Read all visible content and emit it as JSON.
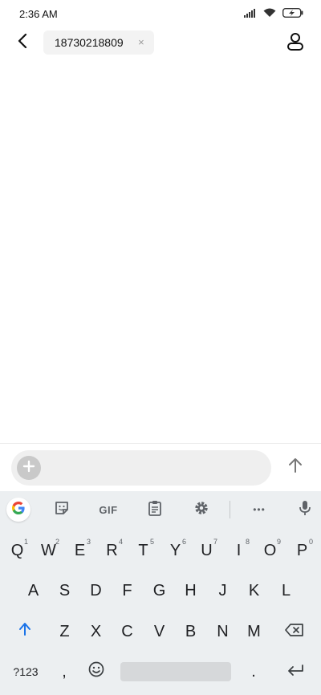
{
  "status": {
    "time": "2:36 AM",
    "icons": [
      "signal-icon",
      "wifi-icon",
      "battery-charging-icon"
    ]
  },
  "header": {
    "back_icon": "back-arrow-icon",
    "recipient": "18730218809",
    "remove_glyph": "×",
    "contact_icon": "person-icon"
  },
  "compose": {
    "placeholder": "",
    "attach_icon": "plus-icon",
    "send_icon": "arrow-up-icon"
  },
  "keyboard": {
    "toolbar": {
      "google_label": "G",
      "sticker_icon": "sticker-icon",
      "gif_label": "GIF",
      "clipboard_icon": "clipboard-icon",
      "settings_icon": "gear-icon",
      "more_label": "•••",
      "mic_icon": "mic-icon"
    },
    "row1": [
      {
        "label": "Q",
        "hint": "1"
      },
      {
        "label": "W",
        "hint": "2"
      },
      {
        "label": "E",
        "hint": "3"
      },
      {
        "label": "R",
        "hint": "4"
      },
      {
        "label": "T",
        "hint": "5"
      },
      {
        "label": "Y",
        "hint": "6"
      },
      {
        "label": "U",
        "hint": "7"
      },
      {
        "label": "I",
        "hint": "8"
      },
      {
        "label": "O",
        "hint": "9"
      },
      {
        "label": "P",
        "hint": "0"
      }
    ],
    "row2": [
      "A",
      "S",
      "D",
      "F",
      "G",
      "H",
      "J",
      "K",
      "L"
    ],
    "row3": [
      "Z",
      "X",
      "C",
      "V",
      "B",
      "N",
      "M"
    ],
    "shift_icon": "shift-arrow-icon",
    "backspace_icon": "backspace-icon",
    "symbols_label": "?123",
    "comma_label": ",",
    "emoji_icon": "emoji-icon",
    "period_label": ".",
    "enter_icon": "enter-icon"
  },
  "colors": {
    "accent_blue": "#1a73e8",
    "keyboard_bg": "#eceff1",
    "chip_bg": "#f3f3f3"
  }
}
